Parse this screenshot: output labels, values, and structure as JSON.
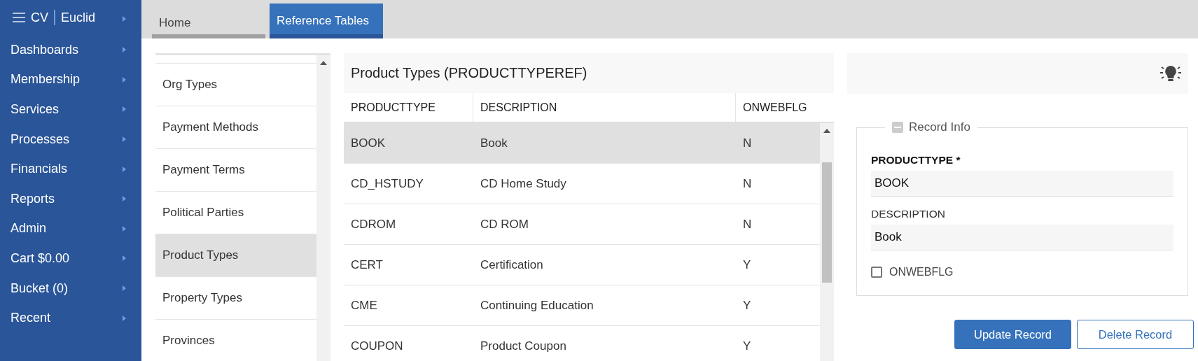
{
  "sidebar": {
    "brand": {
      "left": "CV",
      "right": "Euclid"
    },
    "items": [
      {
        "label": "Dashboards"
      },
      {
        "label": "Membership"
      },
      {
        "label": "Services"
      },
      {
        "label": "Processes"
      },
      {
        "label": "Financials"
      },
      {
        "label": "Reports"
      },
      {
        "label": "Admin"
      },
      {
        "label": "Cart $0.00"
      },
      {
        "label": "Bucket (0)"
      },
      {
        "label": "Recent"
      }
    ]
  },
  "tabs": [
    {
      "label": "Home",
      "selected": false
    },
    {
      "label": "Reference Tables",
      "selected": true
    }
  ],
  "table_list": {
    "items": [
      {
        "label": "Org Types",
        "selected": false
      },
      {
        "label": "Payment Methods",
        "selected": false
      },
      {
        "label": "Payment Terms",
        "selected": false
      },
      {
        "label": "Political Parties",
        "selected": false
      },
      {
        "label": "Product Types",
        "selected": true
      },
      {
        "label": "Property Types",
        "selected": false
      },
      {
        "label": "Provinces",
        "selected": false
      }
    ]
  },
  "table": {
    "title": "Product Types (PRODUCTTYPEREF)",
    "columns": [
      "PRODUCTTYPE",
      "DESCRIPTION",
      "ONWEBFLG"
    ],
    "rows": [
      {
        "cells": [
          "BOOK",
          "Book",
          "N"
        ],
        "selected": true
      },
      {
        "cells": [
          "CD_HSTUDY",
          "CD Home Study",
          "N"
        ],
        "selected": false
      },
      {
        "cells": [
          "CDROM",
          "CD ROM",
          "N"
        ],
        "selected": false
      },
      {
        "cells": [
          "CERT",
          "Certification",
          "Y"
        ],
        "selected": false
      },
      {
        "cells": [
          "CME",
          "Continuing Education",
          "Y"
        ],
        "selected": false
      },
      {
        "cells": [
          "COUPON",
          "Product Coupon",
          "Y"
        ],
        "selected": false
      }
    ]
  },
  "record_info": {
    "legend": "Record Info",
    "producttype_label": "PRODUCTTYPE *",
    "producttype_value": "BOOK",
    "description_label": "DESCRIPTION",
    "description_value": "Book",
    "onwebflg_label": "ONWEBFLG",
    "onwebflg_checked": false
  },
  "buttons": [
    "Update Record",
    "Delete Record"
  ]
}
